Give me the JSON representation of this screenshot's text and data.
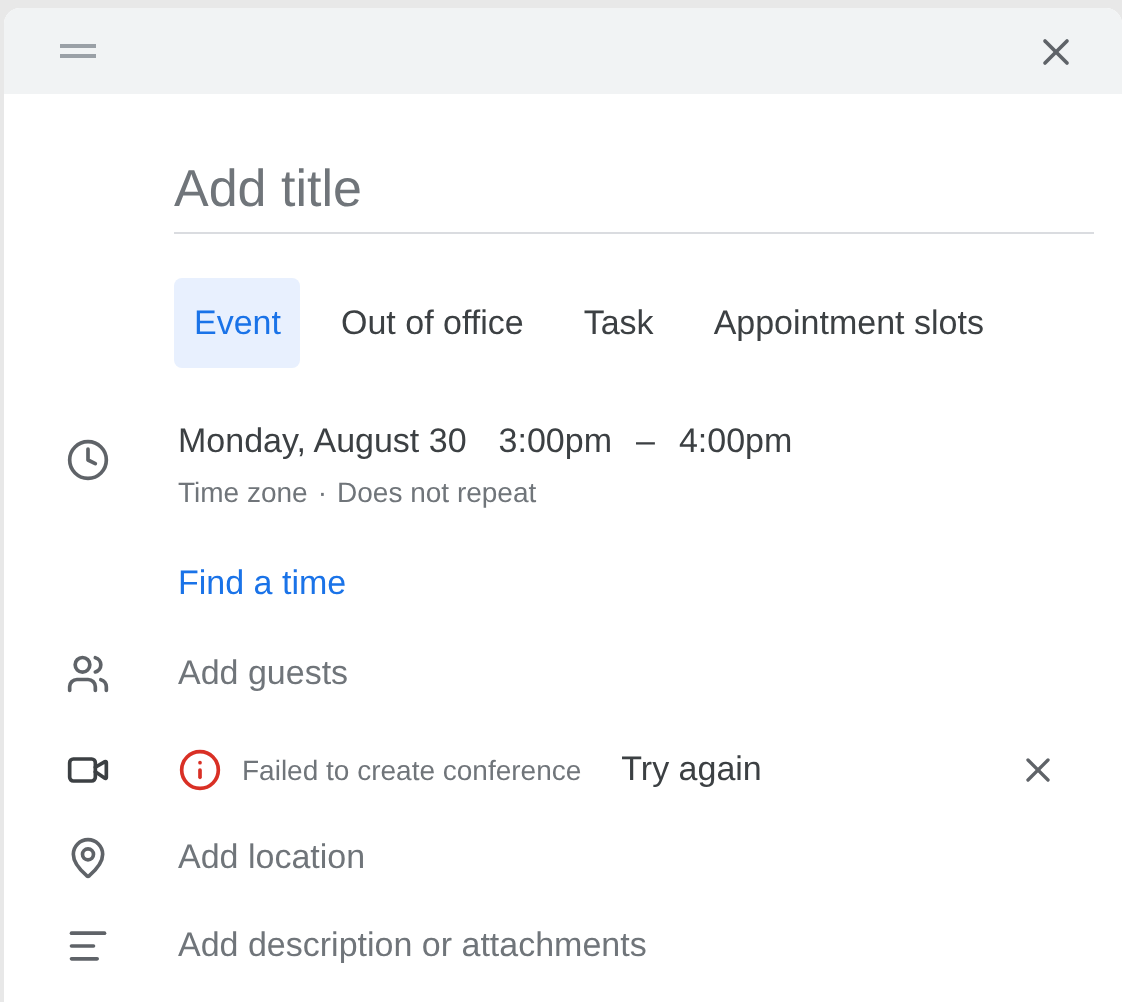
{
  "title_field": {
    "placeholder": "Add title"
  },
  "tabs": [
    {
      "label": "Event",
      "selected": true
    },
    {
      "label": "Out of office",
      "selected": false
    },
    {
      "label": "Task",
      "selected": false
    },
    {
      "label": "Appointment slots",
      "selected": false
    }
  ],
  "when": {
    "date": "Monday, August 30",
    "start": "3:00pm",
    "dash": "–",
    "end": "4:00pm",
    "time_zone": "Time zone",
    "separator": "·",
    "repeat": "Does not repeat",
    "find_time": "Find a time"
  },
  "guests": {
    "placeholder": "Add guests"
  },
  "conference": {
    "error": "Failed to create conference",
    "retry": "Try again"
  },
  "location": {
    "placeholder": "Add location"
  },
  "description": {
    "placeholder": "Add description or attachments"
  }
}
